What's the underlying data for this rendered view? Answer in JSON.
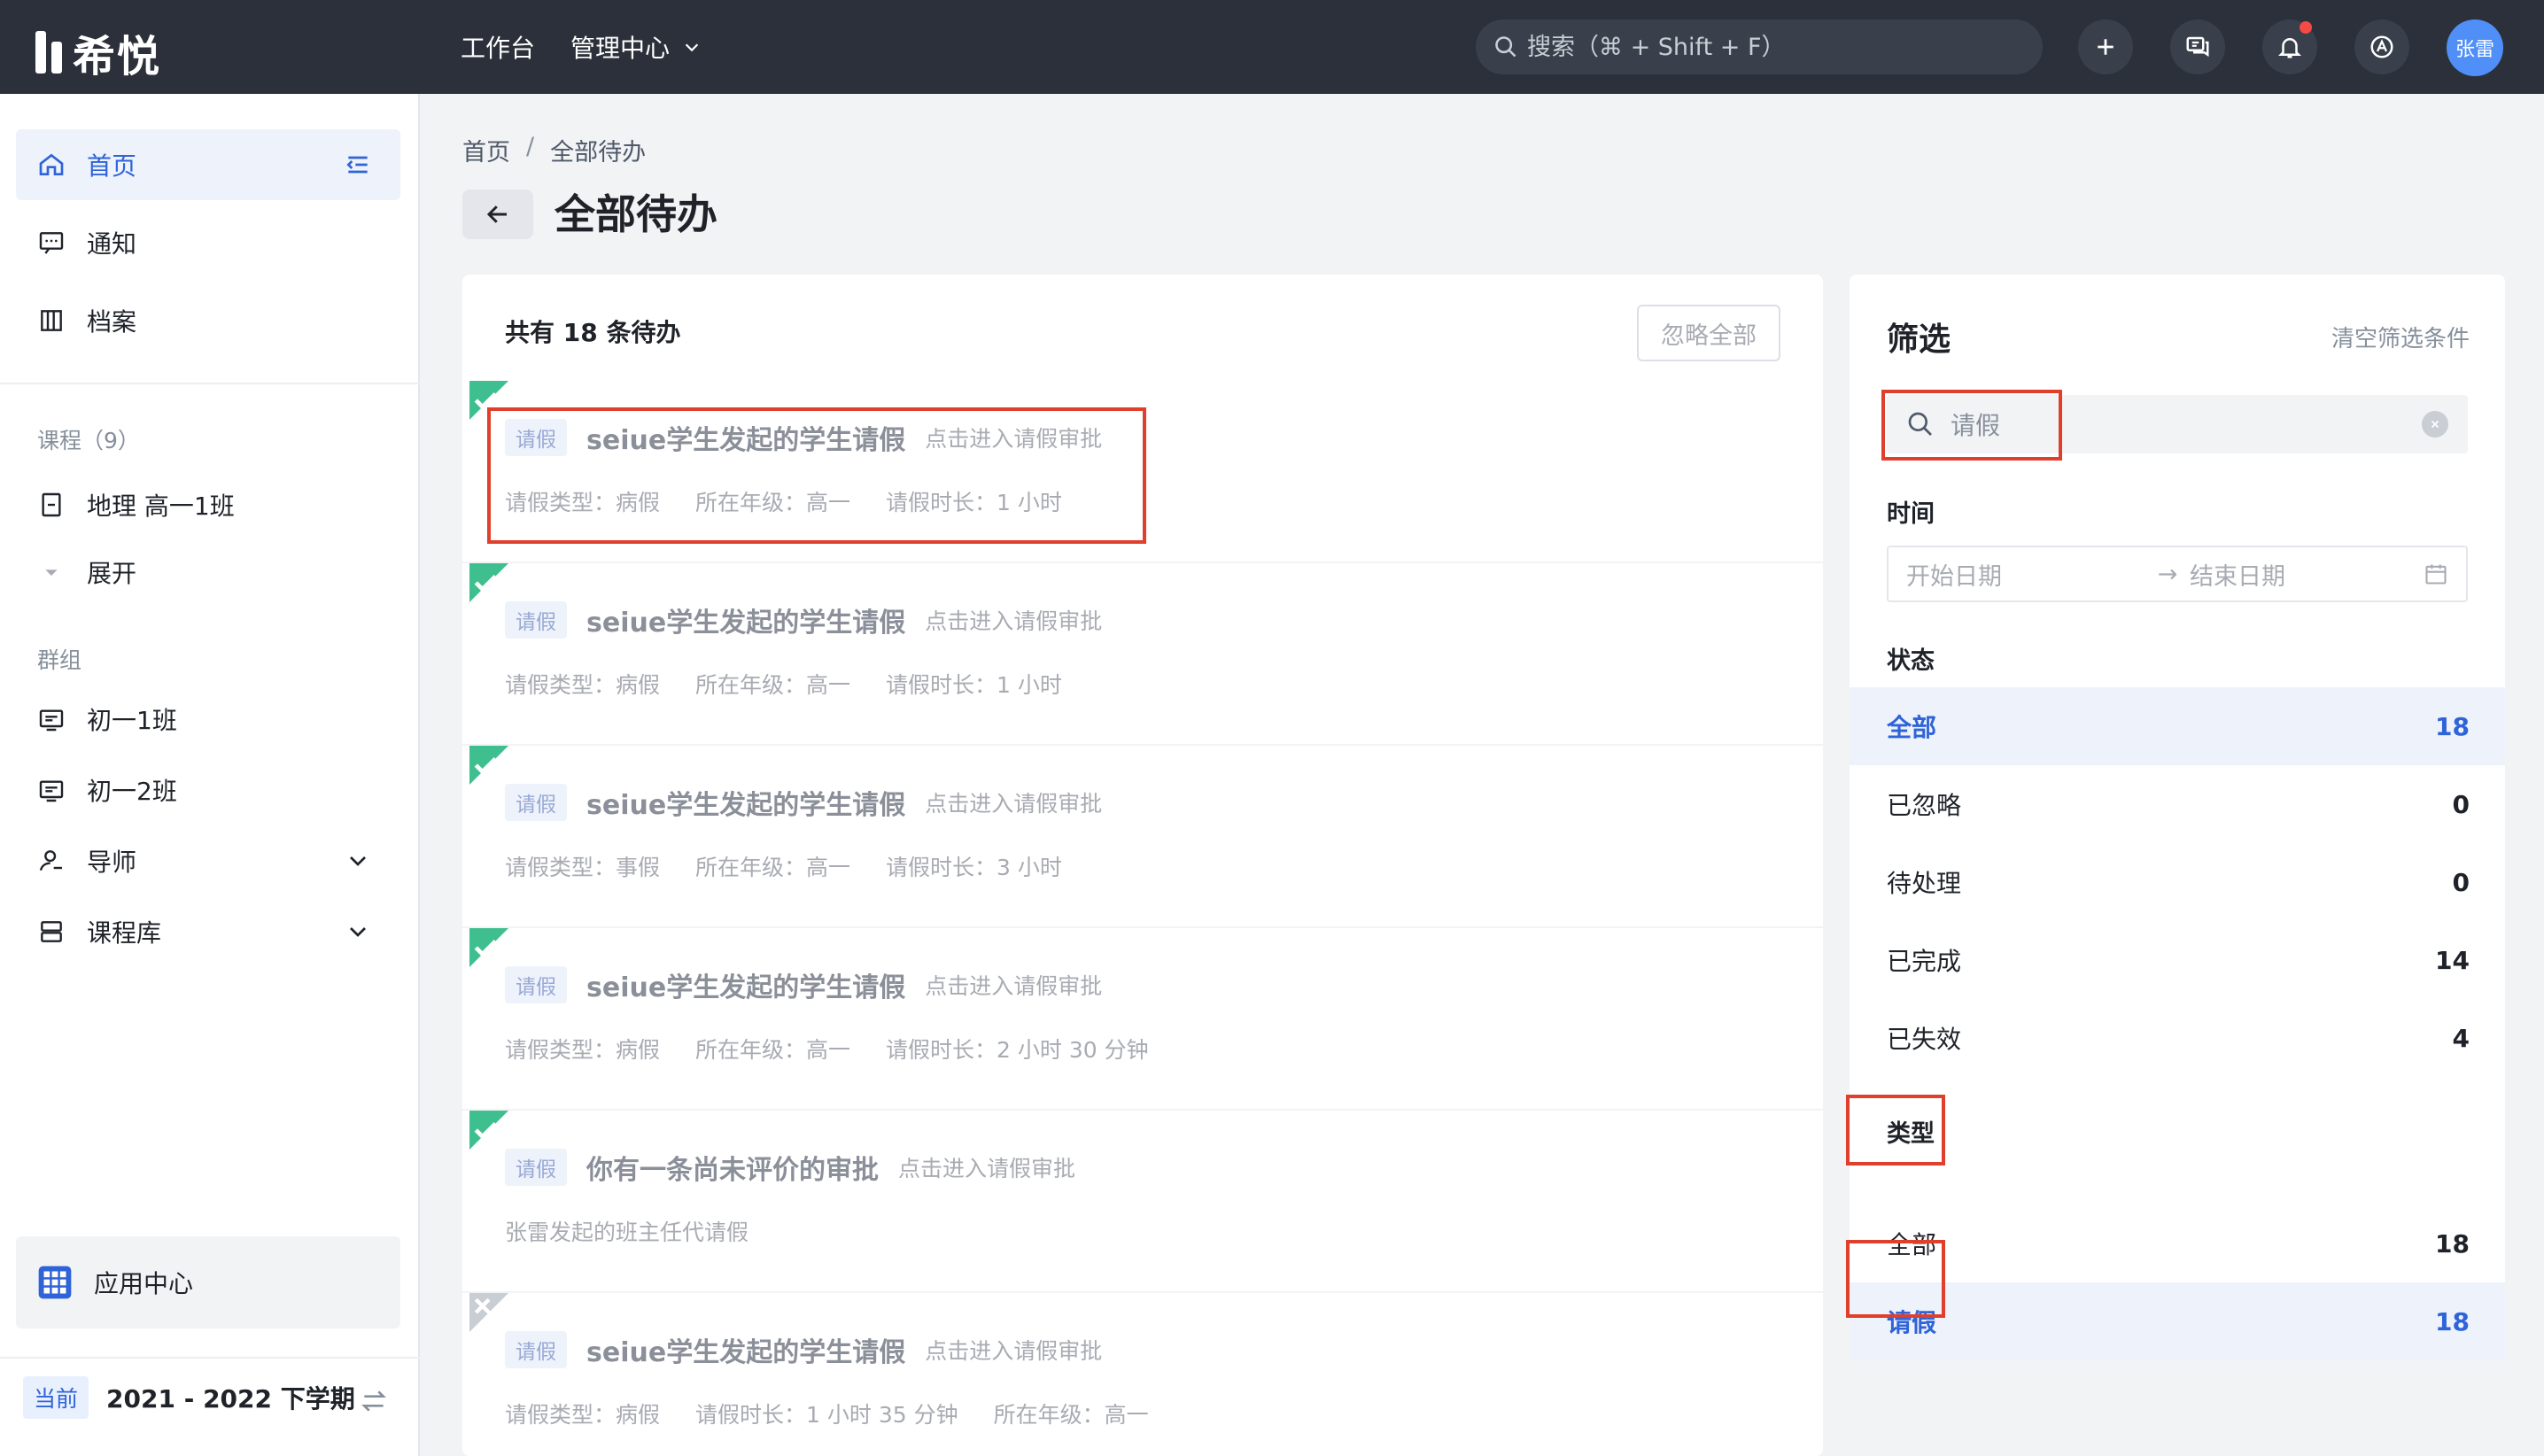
{
  "app": {
    "name": "希悦"
  },
  "topnav": {
    "workbench": "工作台",
    "admin_center": "管理中心"
  },
  "search": {
    "placeholder": "搜索（⌘ + Shift + F）"
  },
  "user": {
    "avatar_text": "张雷"
  },
  "sidebar": {
    "home": "首页",
    "notice": "通知",
    "archive": "档案",
    "courses_section": "课程（9）",
    "course_item": "地理 高一1班",
    "expand": "展开",
    "groups_section": "群组",
    "groups": [
      "初一1班",
      "初一2班"
    ],
    "mentor": "导师",
    "course_library": "课程库",
    "app_center": "应用中心",
    "term_badge": "当前",
    "term": "2021 - 2022 下学期"
  },
  "breadcrumb": {
    "home": "首页",
    "separator": "/",
    "current": "全部待办"
  },
  "page": {
    "title": "全部待办"
  },
  "todo_list": {
    "header": "共有 18 条待办",
    "ignore_all": "忽略全部",
    "items": [
      {
        "status": "done",
        "tag": "请假",
        "title": "seiue学生发起的学生请假",
        "link": "点击进入请假审批",
        "meta": [
          "请假类型：病假",
          "所在年级：高一",
          "请假时长：1 小时"
        ]
      },
      {
        "status": "done",
        "tag": "请假",
        "title": "seiue学生发起的学生请假",
        "link": "点击进入请假审批",
        "meta": [
          "请假类型：病假",
          "所在年级：高一",
          "请假时长：1 小时"
        ]
      },
      {
        "status": "done",
        "tag": "请假",
        "title": "seiue学生发起的学生请假",
        "link": "点击进入请假审批",
        "meta": [
          "请假类型：事假",
          "所在年级：高一",
          "请假时长：3 小时"
        ]
      },
      {
        "status": "done",
        "tag": "请假",
        "title": "seiue学生发起的学生请假",
        "link": "点击进入请假审批",
        "meta": [
          "请假类型：病假",
          "所在年级：高一",
          "请假时长：2 小时 30 分钟"
        ]
      },
      {
        "status": "done",
        "tag": "请假",
        "title": "你有一条尚未评价的审批",
        "link": "点击进入请假审批",
        "meta": [
          "张雷发起的班主任代请假"
        ]
      },
      {
        "status": "expired",
        "tag": "请假",
        "title": "seiue学生发起的学生请假",
        "link": "点击进入请假审批",
        "meta": [
          "请假类型：病假",
          "请假时长：1 小时 35 分钟",
          "所在年级：高一"
        ]
      }
    ]
  },
  "filter": {
    "title": "筛选",
    "clear": "清空筛选条件",
    "search_value": "请假",
    "time_label": "时间",
    "start_placeholder": "开始日期",
    "end_placeholder": "结束日期",
    "status_label": "状态",
    "statuses": [
      {
        "label": "全部",
        "count": "18",
        "selected": true
      },
      {
        "label": "已忽略",
        "count": "0",
        "selected": false
      },
      {
        "label": "待处理",
        "count": "0",
        "selected": false
      },
      {
        "label": "已完成",
        "count": "14",
        "selected": false
      },
      {
        "label": "已失效",
        "count": "4",
        "selected": false
      }
    ],
    "type_label": "类型",
    "types": [
      {
        "label": "全部",
        "count": "18",
        "selected": false
      },
      {
        "label": "请假",
        "count": "18",
        "selected": true
      }
    ]
  },
  "colors": {
    "topbar": "#2b303a",
    "accent": "#2f63d8",
    "done_flag": "#3fbf8f",
    "expired_flag": "#c9cdd4",
    "highlight_box": "#e0402b"
  }
}
